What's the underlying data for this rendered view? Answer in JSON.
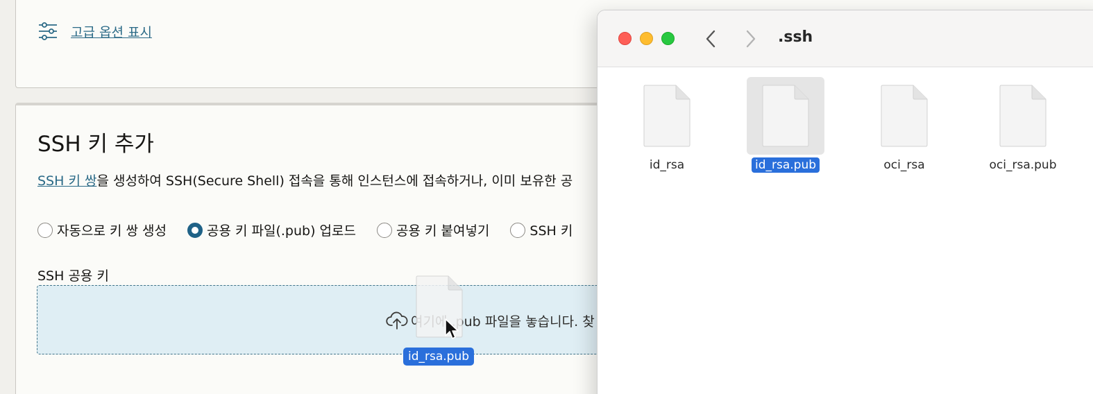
{
  "advanced": {
    "label": "고급 옵션 표시",
    "icon": "sliders-icon"
  },
  "ssh_section": {
    "title": "SSH 키 추가",
    "desc_link": "SSH 키 쌍",
    "desc_rest": "을 생성하여 SSH(Secure Shell) 접속을 통해 인스턴스에 접속하거나, 이미 보유한 공",
    "options": [
      {
        "label": "자동으로 키 쌍 생성",
        "selected": false
      },
      {
        "label": "공용 키 파일(.pub) 업로드",
        "selected": true
      },
      {
        "label": "공용 키 붙여넣기",
        "selected": false
      },
      {
        "label": "SSH 키",
        "selected": false
      }
    ],
    "public_key_label": "SSH 공용 키",
    "dropzone_text": "여기에 .pub 파일을 놓습니다. 찾",
    "dropzone_icon": "cloud-upload-icon"
  },
  "drag": {
    "file_label": "id_rsa.pub"
  },
  "finder": {
    "title": ".ssh",
    "files": [
      {
        "name": "id_rsa",
        "selected": false
      },
      {
        "name": "id_rsa.pub",
        "selected": true
      },
      {
        "name": "oci_rsa",
        "selected": false
      },
      {
        "name": "oci_rsa.pub",
        "selected": false
      }
    ]
  },
  "colors": {
    "accent": "#2a6fdb",
    "link": "#2b6a87",
    "radio_on": "#1f6287"
  }
}
